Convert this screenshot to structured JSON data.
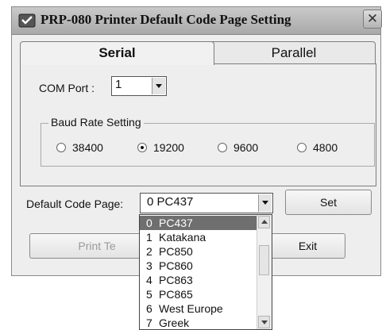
{
  "window": {
    "title": "PRP-080 Printer Default Code Page Setting",
    "close_label": "✕"
  },
  "tabs": [
    {
      "label": "Serial",
      "active": true
    },
    {
      "label": "Parallel",
      "active": false
    }
  ],
  "serial": {
    "com_port_label": "COM Port :",
    "com_port_value": "1",
    "baud_group_label": "Baud Rate Setting",
    "baud_options": [
      {
        "label": "38400",
        "selected": false
      },
      {
        "label": "19200",
        "selected": true
      },
      {
        "label": "9600",
        "selected": false
      },
      {
        "label": "4800",
        "selected": false
      }
    ]
  },
  "code_page": {
    "label": "Default Code Page:",
    "selected_value": "0  PC437",
    "set_button": "Set",
    "options": [
      {
        "num": "0",
        "name": "PC437",
        "selected": true
      },
      {
        "num": "1",
        "name": "Katakana",
        "selected": false
      },
      {
        "num": "2",
        "name": "PC850",
        "selected": false
      },
      {
        "num": "3",
        "name": "PC860",
        "selected": false
      },
      {
        "num": "4",
        "name": "PC863",
        "selected": false
      },
      {
        "num": "5",
        "name": "PC865",
        "selected": false
      },
      {
        "num": "6",
        "name": "West Europe",
        "selected": false
      },
      {
        "num": "7",
        "name": "Greek",
        "selected": false
      }
    ]
  },
  "buttons": {
    "print_test": "Print Te",
    "exit": "Exit"
  }
}
